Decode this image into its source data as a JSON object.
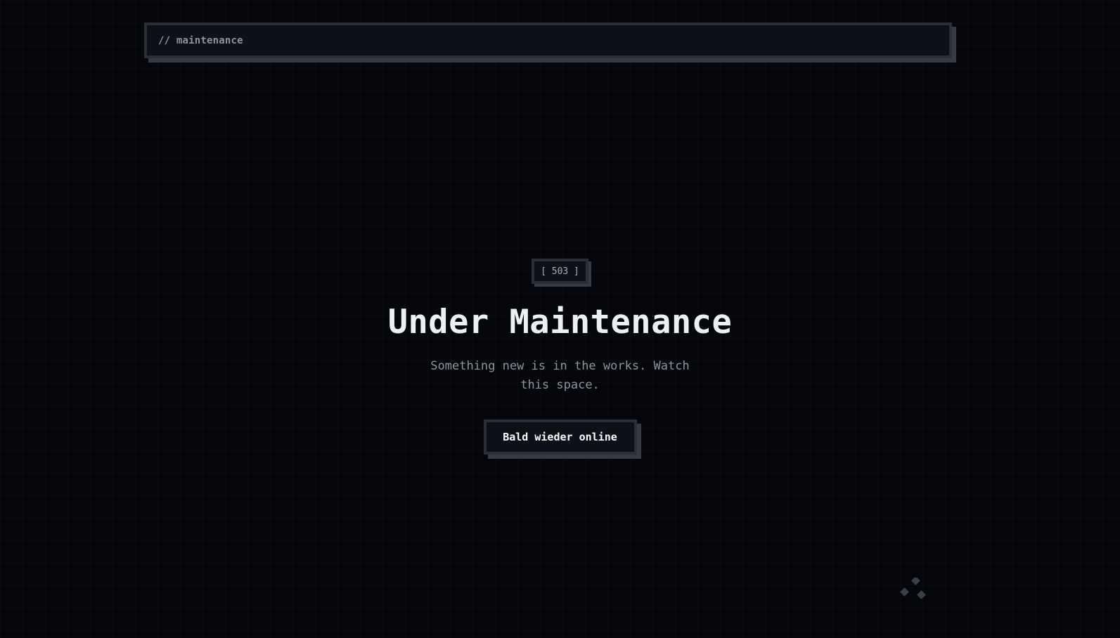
{
  "header": {
    "label": "// maintenance"
  },
  "status": {
    "code_badge": "[ 503 ]",
    "title": "Under Maintenance",
    "subtitle": "Something new is in the works. Watch this space.",
    "button_label": "Bald wieder online"
  },
  "decoration": {
    "icon": "diamonds-icon",
    "color": "#3a3e47"
  },
  "colors": {
    "background": "#04060b",
    "panel": "#0d1017",
    "border": "#2a2e37",
    "shadow": "#363a43",
    "title_text": "#eceff3",
    "muted_text": "#8f949c"
  }
}
